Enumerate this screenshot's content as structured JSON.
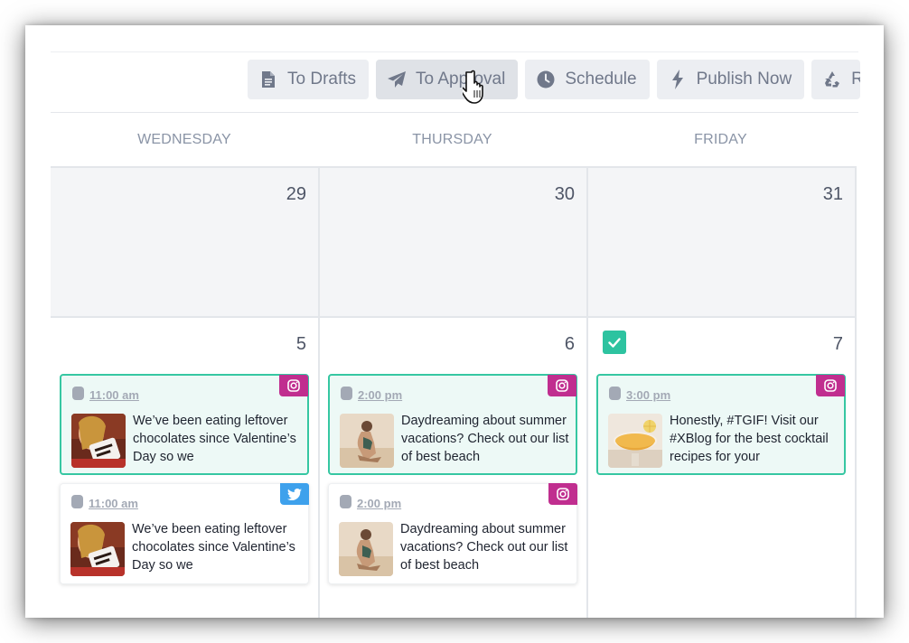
{
  "toolbar": {
    "buttons": [
      {
        "label": "To Drafts",
        "icon": "document-icon"
      },
      {
        "label": "To Approval",
        "icon": "paper-plane-icon"
      },
      {
        "label": "Schedule",
        "icon": "clock-icon"
      },
      {
        "label": "Publish Now",
        "icon": "lightning-icon"
      },
      {
        "label": "R",
        "icon": "recycle-icon"
      }
    ]
  },
  "calendar": {
    "days": [
      "WEDNESDAY",
      "THURSDAY",
      "FRIDAY"
    ],
    "week1": [
      "29",
      "30",
      "31"
    ],
    "week2": [
      "5",
      "6",
      "7"
    ]
  },
  "posts": {
    "wed_1": {
      "time": "11:00 am",
      "network": "instagram-icon",
      "caption": "We’ve been eating leftover chocolates since Valentine’s Day so we"
    },
    "wed_2": {
      "time": "11:00 am",
      "network": "twitter-icon",
      "caption": "We’ve been eating leftover chocolates since Valentine’s Day so we"
    },
    "thu_1": {
      "time": "2:00 pm",
      "network": "instagram-icon",
      "caption": "Daydreaming about summer vacations? Check out our list of best beach"
    },
    "thu_2": {
      "time": "2:00 pm",
      "network": "instagram-icon",
      "caption": "Daydreaming about summer vacations? Check out our list of best beach"
    },
    "fri_1": {
      "time": "3:00 pm",
      "network": "instagram-icon",
      "caption": "Honestly, #TGIF! Visit our #XBlog for the best cocktail recipes for your"
    }
  },
  "colors": {
    "approved_border": "#36c7a2",
    "approved_bg": "#edf9f6",
    "instagram": "#c02e8f",
    "twitter": "#3ea1ec",
    "check_badge": "#2dc3a0"
  }
}
